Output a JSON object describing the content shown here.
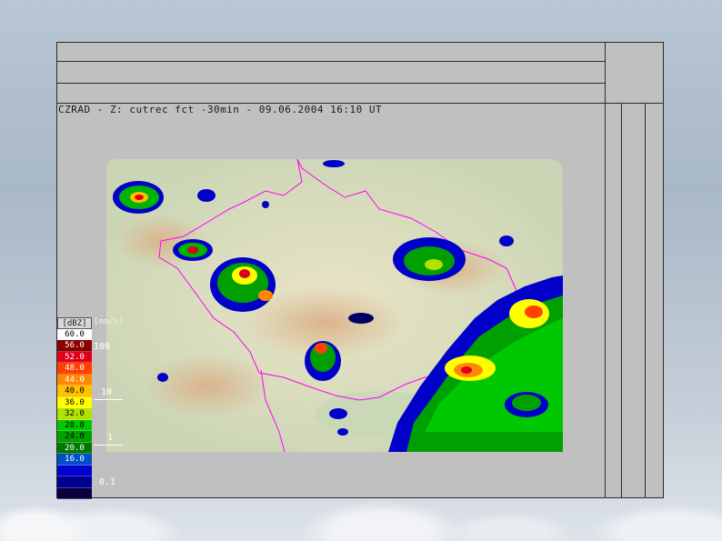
{
  "radar": {
    "title": "CZRAD - Z: cutrec fct -30min - 09.06.2004 16:10 UT"
  },
  "legend": {
    "dbz_header": "[dBZ]",
    "mm_header": "[mm/h]",
    "levels": [
      {
        "label": "60.0",
        "color": "#ffffff",
        "text": "#000000"
      },
      {
        "label": "56.0",
        "color": "#8b0000",
        "text": "#ffffff"
      },
      {
        "label": "52.0",
        "color": "#e0001a",
        "text": "#ffffff"
      },
      {
        "label": "48.0",
        "color": "#ff4000",
        "text": "#ffffff"
      },
      {
        "label": "44.0",
        "color": "#ff8800",
        "text": "#ffffff"
      },
      {
        "label": "40.0",
        "color": "#ffc000",
        "text": "#000000"
      },
      {
        "label": "36.0",
        "color": "#ffff00",
        "text": "#000000"
      },
      {
        "label": "32.0",
        "color": "#b4e000",
        "text": "#000000"
      },
      {
        "label": "28.0",
        "color": "#00c800",
        "text": "#000000"
      },
      {
        "label": "24.0",
        "color": "#00a000",
        "text": "#000000"
      },
      {
        "label": "20.0",
        "color": "#007800",
        "text": "#ffffff"
      },
      {
        "label": "16.0",
        "color": "#0050c8",
        "text": "#ffffff"
      },
      {
        "label": "",
        "color": "#0000d0",
        "text": "#ffffff"
      },
      {
        "label": "",
        "color": "#000090",
        "text": "#ffffff"
      },
      {
        "label": "",
        "color": "#0a0040",
        "text": "#ffffff"
      }
    ],
    "mm_labels": [
      "100",
      "10",
      "1",
      "0.1"
    ]
  },
  "colors": {
    "border": "#ff00ff",
    "panel": "#c0c0c0"
  }
}
